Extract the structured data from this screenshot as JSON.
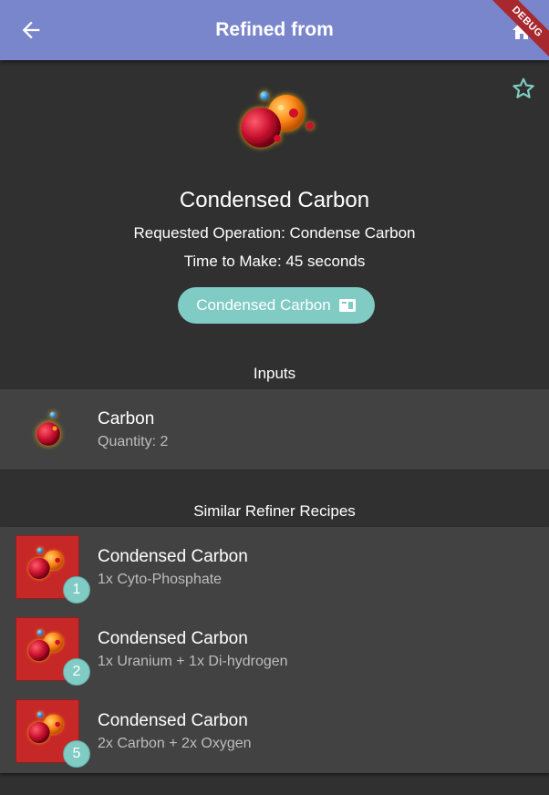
{
  "appbar": {
    "title": "Refined from",
    "back_icon": "arrow-back-icon",
    "home_icon": "home-icon",
    "color": "#7986cb"
  },
  "debug_banner": "DEBUG",
  "item": {
    "name": "Condensed Carbon",
    "operation": "Requested Operation: Condense Carbon",
    "time": "Time to Make: 45 seconds",
    "chip_label": "Condensed Carbon",
    "chip_color": "#80cbc4"
  },
  "inputs": {
    "header": "Inputs",
    "items": [
      {
        "name": "Carbon",
        "quantity": "Quantity: 2"
      }
    ]
  },
  "similar": {
    "header": "Similar Refiner Recipes",
    "items": [
      {
        "name": "Condensed Carbon",
        "recipe": "1x Cyto-Phosphate",
        "badge": "1"
      },
      {
        "name": "Condensed Carbon",
        "recipe": "1x Uranium + 1x Di-hydrogen",
        "badge": "2"
      },
      {
        "name": "Condensed Carbon",
        "recipe": "2x Carbon + 2x Oxygen",
        "badge": "5"
      }
    ]
  }
}
